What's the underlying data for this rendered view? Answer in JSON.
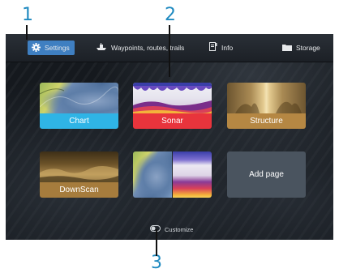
{
  "callouts": {
    "one": "1",
    "two": "2",
    "three": "3"
  },
  "topbar": {
    "settings_label": "Settings",
    "waypoints_label": "Waypoints, routes, trails",
    "info_label": "Info",
    "storage_label": "Storage"
  },
  "tiles": [
    {
      "label": "Chart",
      "color": "#2fb4e6"
    },
    {
      "label": "Sonar",
      "color": "#e8343c"
    },
    {
      "label": "Structure",
      "color": "#b58743"
    },
    {
      "label": "DownScan",
      "color": "#a67c3d"
    },
    {
      "label": "",
      "color": ""
    },
    {
      "label": "Add page",
      "color": "#4a545f"
    }
  ],
  "footer": {
    "customize_label": "Customize"
  },
  "colors": {
    "accent": "#3f7fc1",
    "callout": "#1f8ac0",
    "background": "#15191e"
  },
  "icons": {
    "settings": "gear-icon",
    "waypoints": "boat-icon",
    "info": "document-info-icon",
    "storage": "folder-icon",
    "customize": "toggle-icon"
  }
}
